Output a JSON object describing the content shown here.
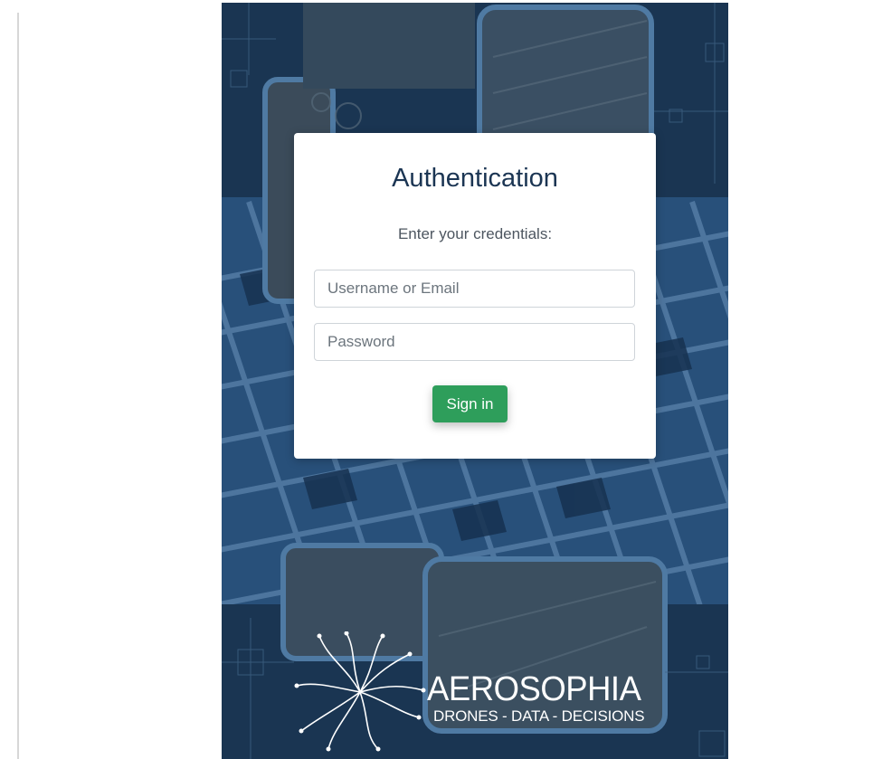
{
  "auth": {
    "title": "Authentication",
    "subtitle": "Enter your credentials:",
    "username_placeholder": "Username or Email",
    "password_placeholder": "Password",
    "signin_label": "Sign in"
  },
  "brand": {
    "name": "AEROSOPHIA",
    "tagline": "DRONES - DATA - DECISIONS"
  },
  "colors": {
    "background_navy": "#1d3a57",
    "grid_line": "#4a6f93",
    "title_text": "#1b3553",
    "signin_green": "#2e9e5b"
  }
}
